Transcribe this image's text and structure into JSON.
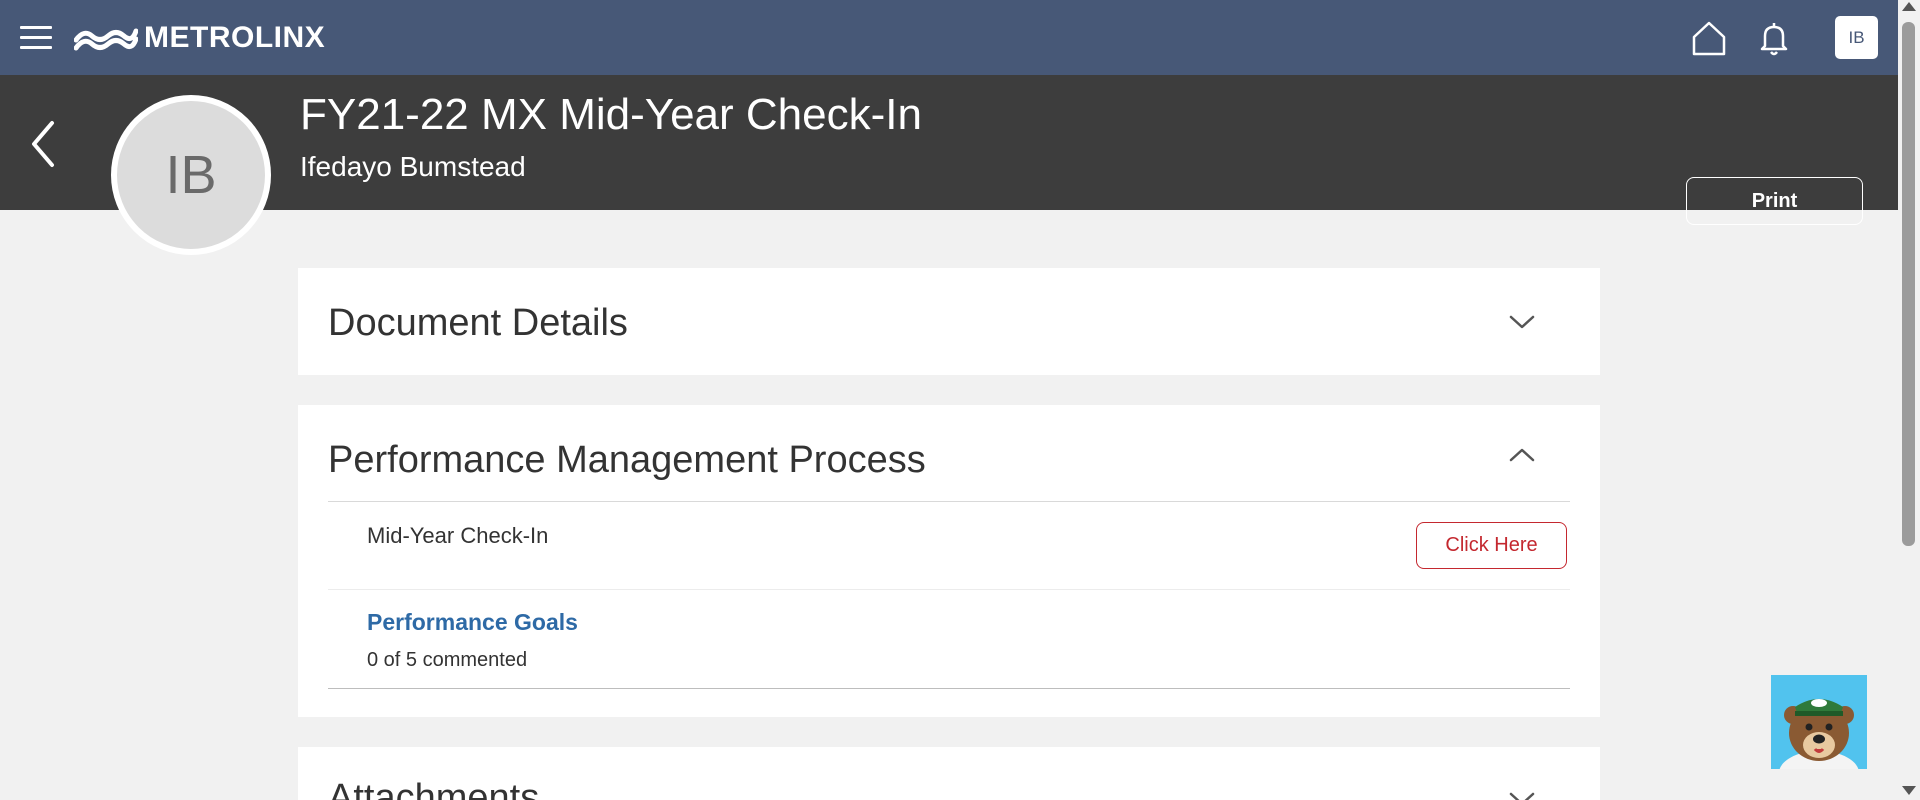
{
  "topbar": {
    "brand": "METROLINX",
    "user_initials": "IB",
    "color": "#475877"
  },
  "header": {
    "title": "FY21-22 MX Mid-Year Check-In",
    "person_name": "Ifedayo Bumstead",
    "avatar_initials": "IB",
    "print_label": "Print",
    "color": "#3d3d3d"
  },
  "sections": {
    "document_details": {
      "title": "Document Details",
      "expanded": false
    },
    "performance_process": {
      "title": "Performance Management Process",
      "expanded": true,
      "midyear": {
        "label": "Mid-Year Check-In",
        "action_label": "Click Here"
      },
      "goals": {
        "link": "Performance Goals",
        "status": "0 of 5 commented"
      }
    },
    "attachments": {
      "title": "Attachments",
      "expanded": false
    }
  },
  "icons": {
    "menu": "hamburger-icon",
    "home": "home-icon",
    "notifications": "bell-icon",
    "back": "chevron-left-icon",
    "expand": "chevron-down-icon",
    "collapse": "chevron-up-icon",
    "chatbot": "bear-mascot-icon"
  },
  "colors": {
    "accent_red": "#c4282f",
    "link_blue": "#2e6aa6",
    "page_bg": "#f1f1f1"
  }
}
